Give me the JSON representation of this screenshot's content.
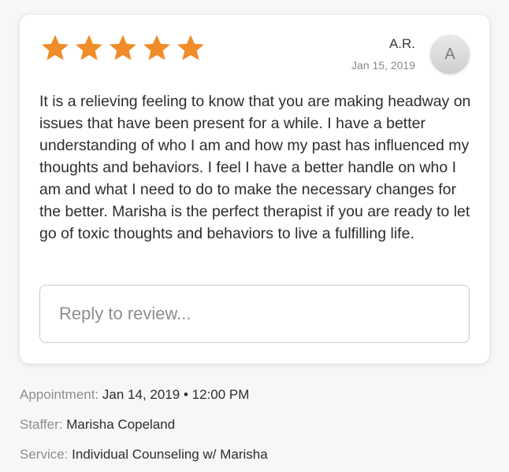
{
  "review": {
    "rating": 5,
    "max_rating": 5,
    "star_color": "#f08c2a",
    "author_name": "A.R.",
    "author_initial": "A",
    "date": "Jan 15, 2019",
    "text": "It is a relieving feeling to know that you are making headway on issues that have been present for a while. I have a better understanding of who I am and how my past has influenced my thoughts and behaviors. I feel I have a better handle on who I am and what I need to do to make the necessary changes for the better. Marisha is the perfect therapist if you are ready to let go of toxic thoughts and behaviors to live a fulfilling life.",
    "reply_placeholder": "Reply to review..."
  },
  "details": {
    "appointment_label": "Appointment:",
    "appointment_date": "Jan 14, 2019",
    "appointment_separator": "•",
    "appointment_time": "12:00 PM",
    "staffer_label": "Staffer:",
    "staffer_value": "Marisha Copeland",
    "service_label": "Service:",
    "service_value": "Individual Counseling w/ Marisha"
  }
}
